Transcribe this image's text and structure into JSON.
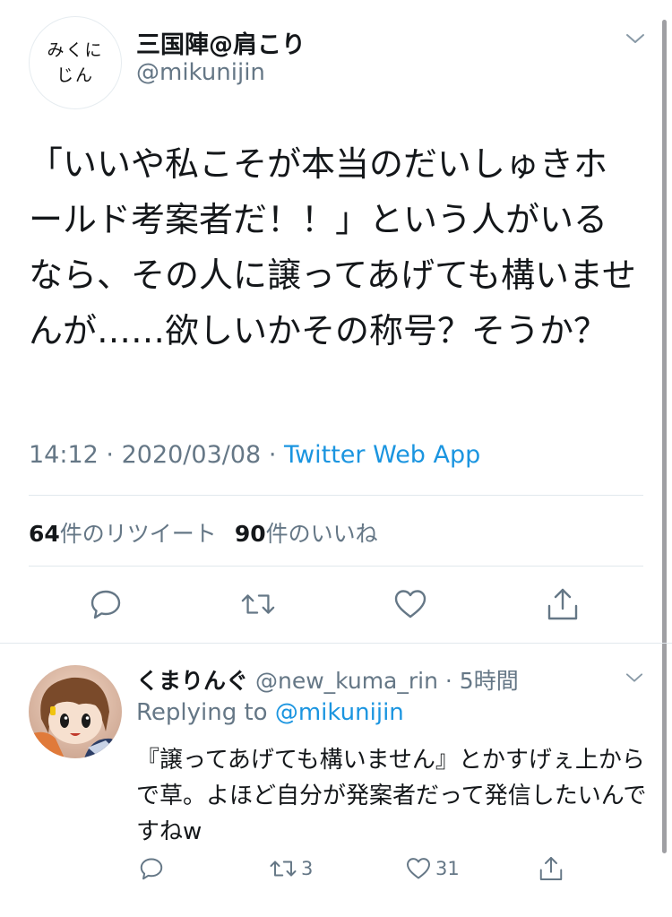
{
  "main_tweet": {
    "avatar_text_line1": "みくに",
    "avatar_text_line2": "じん",
    "display_name": "三国陣@肩こり",
    "handle": "@mikunijin",
    "text": "「いいや私こそが本当のだいしゅきホールド考案者だ！！」という人がいるなら、その人に譲ってあげても構いませんが……欲しいかその称号？そうか？",
    "time": "14:12",
    "date": "2020/03/08",
    "separator": "·",
    "app": "Twitter Web App",
    "retweet_count": "64",
    "retweet_label": "件のリツイート",
    "like_count": "90",
    "like_label": "件のいいね",
    "icons": [
      "chevron-down-icon",
      "reply-icon",
      "retweet-icon",
      "like-icon",
      "share-icon"
    ]
  },
  "reply_tweet": {
    "display_name": "くまりんぐ",
    "handle": "@new_kuma_rin",
    "separator": "·",
    "time_ago": "5時間",
    "replying_prefix": "Replying to",
    "replying_to": "@mikunijin",
    "text": "『譲ってあげても構いません』とかすげぇ上からで草。よほど自分が発案者だって発信したいんですねw",
    "retweet_count": "3",
    "like_count": "31",
    "icons": [
      "chevron-down-icon",
      "reply-icon",
      "retweet-icon",
      "like-icon",
      "share-icon"
    ]
  },
  "colors": {
    "text_primary": "#14171a",
    "text_secondary": "#657786",
    "link": "#1b95e0",
    "divider": "#e1e8ed"
  }
}
